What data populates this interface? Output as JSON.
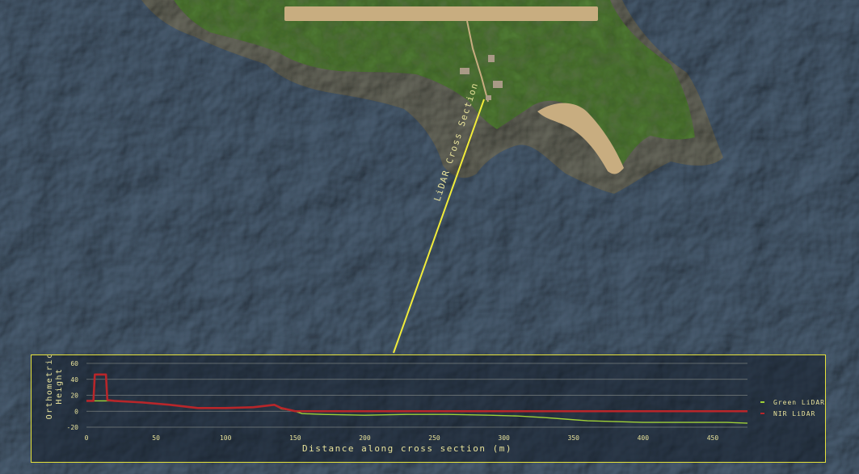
{
  "map": {
    "section_label": "LiDAR Cross Section",
    "colors": {
      "ocean": "#4b5f73",
      "land": "#4f7a33",
      "sand": "#c8ad80",
      "rock": "#6a6b5f",
      "section_line": "#f1ec3a"
    }
  },
  "chart_data": {
    "type": "line",
    "xlabel": "Distance along cross section (m)",
    "ylabel": "Orthometric Height",
    "xlim": [
      0,
      475
    ],
    "ylim": [
      -20,
      60
    ],
    "xticks": [
      0,
      50,
      100,
      150,
      200,
      250,
      300,
      350,
      400,
      450
    ],
    "yticks": [
      -20,
      0,
      20,
      40,
      60
    ],
    "grid": true,
    "legend_position": "right",
    "series": [
      {
        "name": "Green LiDAR",
        "color": "#9fd037",
        "x": [
          0,
          20,
          40,
          60,
          80,
          100,
          120,
          135,
          140,
          148,
          155,
          170,
          200,
          230,
          260,
          290,
          310,
          330,
          345,
          360,
          380,
          400,
          430,
          460,
          475
        ],
        "y": [
          13,
          13,
          11,
          8,
          4,
          4,
          5,
          8,
          3,
          1,
          -3,
          -4,
          -5,
          -4,
          -4,
          -5,
          -6,
          -8,
          -10,
          -12,
          -13,
          -14,
          -14,
          -14,
          -15
        ]
      },
      {
        "name": "NIR LiDAR",
        "color": "#b8262a",
        "x": [
          0,
          5,
          6,
          14,
          15,
          20,
          40,
          60,
          80,
          100,
          120,
          130,
          135,
          140,
          145,
          150,
          200,
          300,
          400,
          475
        ],
        "y": [
          13,
          13,
          46,
          46,
          14,
          13,
          11,
          8,
          4,
          4,
          5,
          7,
          8,
          4,
          2,
          0,
          0,
          0,
          0,
          0
        ]
      }
    ]
  }
}
